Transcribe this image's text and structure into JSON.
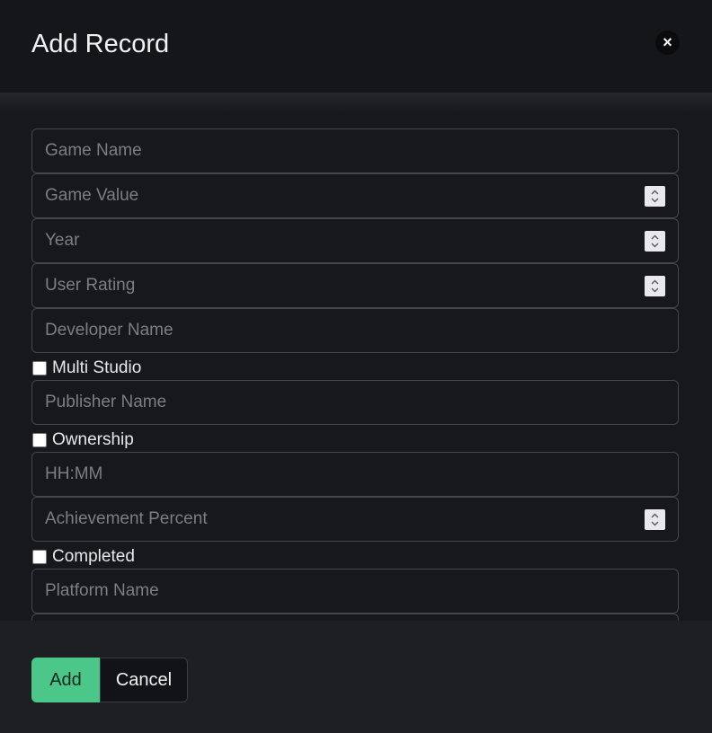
{
  "dialog": {
    "title": "Add Record",
    "close_glyph": "×"
  },
  "form": {
    "game_name_placeholder": "Game Name",
    "game_value_placeholder": "Game Value",
    "year_placeholder": "Year",
    "user_rating_placeholder": "User Rating",
    "developer_name_placeholder": "Developer Name",
    "multi_studio_label": "Multi Studio",
    "publisher_name_placeholder": "Publisher Name",
    "ownership_label": "Ownership",
    "playtime_placeholder": "HH:MM",
    "achievement_percent_placeholder": "Achievement Percent",
    "completed_label": "Completed",
    "platform_name_placeholder": "Platform Name"
  },
  "footer": {
    "add_label": "Add",
    "cancel_label": "Cancel"
  },
  "colors": {
    "accent": "#4cc78a",
    "background": "#17181c"
  }
}
